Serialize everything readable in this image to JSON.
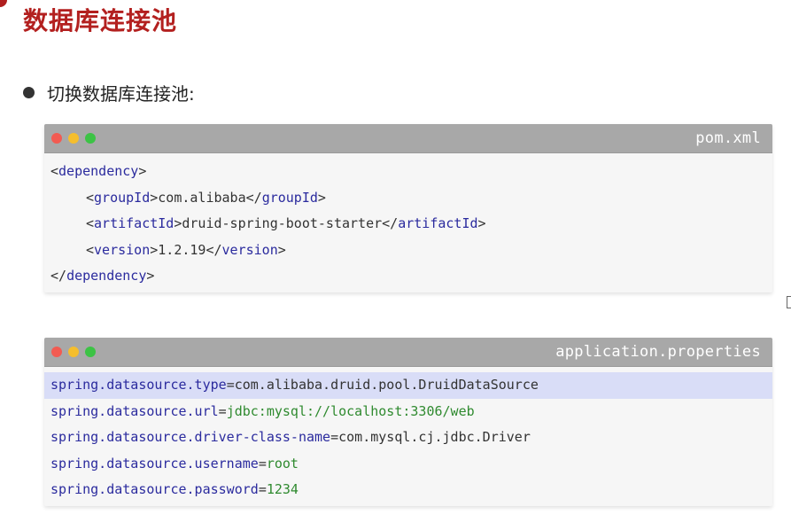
{
  "page": {
    "title": "数据库连接池",
    "bullet": "切换数据库连接池:",
    "accent_color": "#b3201f"
  },
  "pom_window": {
    "filename": "pom.xml",
    "lines": [
      {
        "indent": 0,
        "open": "dependency"
      },
      {
        "indent": 1,
        "tag": "groupId",
        "value": "com.alibaba"
      },
      {
        "indent": 1,
        "tag": "artifactId",
        "value": "druid-spring-boot-starter"
      },
      {
        "indent": 1,
        "tag": "version",
        "value": "1.2.19"
      },
      {
        "indent": 0,
        "close": "dependency"
      }
    ]
  },
  "app_window": {
    "filename": "application.properties",
    "lines": [
      {
        "key": "spring.datasource.type",
        "value": "com.alibaba.druid.pool.DruidDataSource",
        "highlight": true
      },
      {
        "key": "spring.datasource.url",
        "value": "jdbc:mysql://localhost:3306/web",
        "green": true
      },
      {
        "key": "spring.datasource.driver-class-name",
        "value": "com.mysql.cj.jdbc.Driver"
      },
      {
        "key": "spring.datasource.username",
        "value": "root",
        "green": true
      },
      {
        "key": "spring.datasource.password",
        "value": "1234",
        "green": true
      }
    ]
  }
}
